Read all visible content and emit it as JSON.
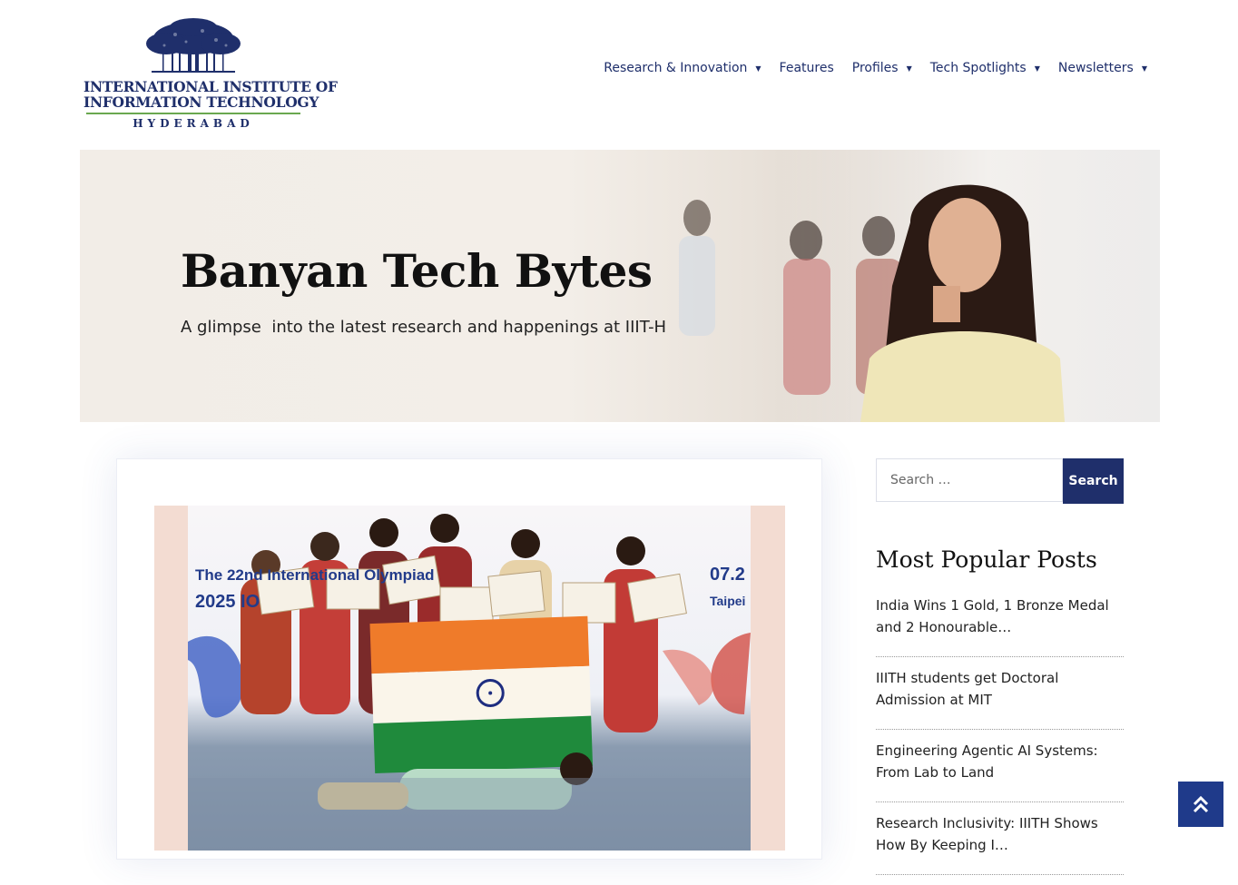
{
  "logo": {
    "line1": "INTERNATIONAL INSTITUTE OF",
    "line2": "INFORMATION TECHNOLOGY",
    "city": "HYDERABAD"
  },
  "nav": {
    "items": [
      {
        "label": "Research & Innovation",
        "has_dropdown": true
      },
      {
        "label": "Features",
        "has_dropdown": false
      },
      {
        "label": "Profiles",
        "has_dropdown": true
      },
      {
        "label": "Tech Spotlights",
        "has_dropdown": true
      },
      {
        "label": "Newsletters",
        "has_dropdown": true
      }
    ]
  },
  "hero": {
    "title": "Banyan Tech Bytes",
    "subtitle": "A glimpse  into the latest research and happenings at IIIT-H"
  },
  "feature_photo": {
    "banner_text": "The 22nd International Olympiad",
    "banner_year": "2025 IO",
    "banner_date": "07.2",
    "banner_city": "Taipei"
  },
  "sidebar": {
    "search_placeholder": "Search …",
    "search_button": "Search",
    "popular_title": "Most Popular Posts",
    "popular_posts": [
      "India Wins 1 Gold, 1 Bronze Medal and 2 Honourable…",
      "IIITH students get Doctoral Admission at MIT",
      "Engineering Agentic AI Systems: From Lab to Land",
      "Research Inclusivity: IIITH Shows How By Keeping I…"
    ]
  },
  "colors": {
    "brand_navy": "#1f2f6b",
    "logo_green": "#6aa84f",
    "scroll_top_bg": "#1f3a8a"
  },
  "icons": {
    "scroll_top": "double-chevron-up-icon",
    "dropdown": "caret-down-icon"
  }
}
